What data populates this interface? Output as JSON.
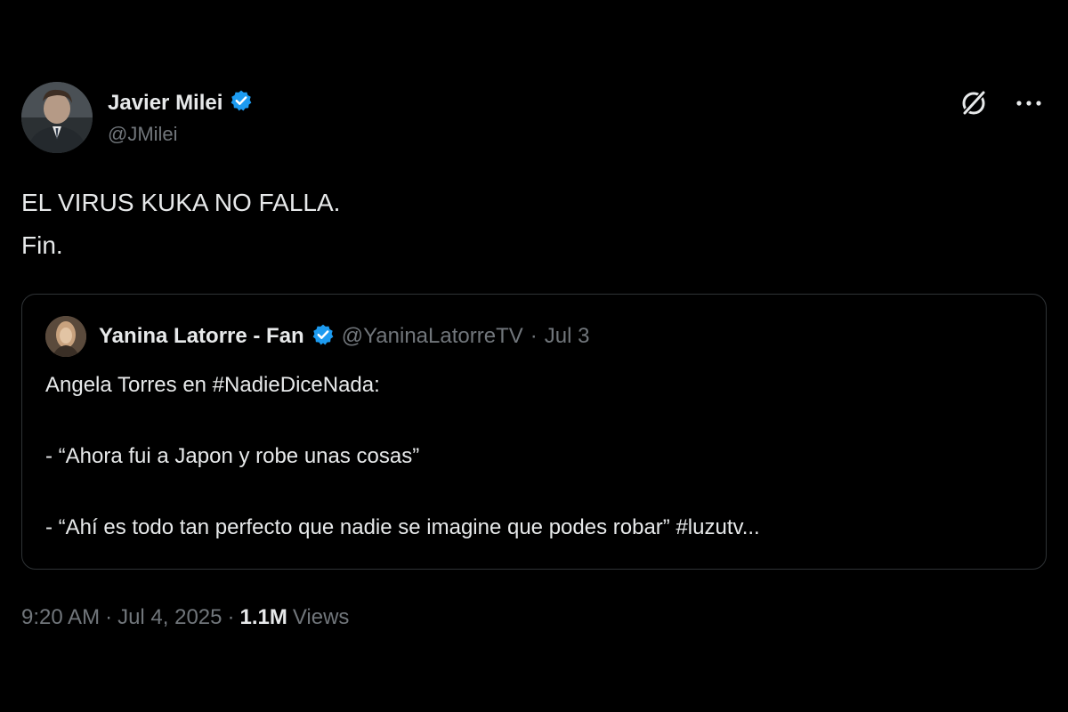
{
  "author": {
    "name": "Javier Milei",
    "handle": "@JMilei",
    "verified": true
  },
  "tweet": {
    "lines": [
      "EL VIRUS KUKA NO FALLA.",
      "Fin."
    ]
  },
  "quoted": {
    "name": "Yanina Latorre - Fan",
    "handle": "@YaninaLatorreTV",
    "separator": "·",
    "date": "Jul 3",
    "verified": true,
    "lines": [
      "Angela Torres en #NadieDiceNada:",
      "- “Ahora fui a Japon y robe unas cosas”",
      "- “Ahí es todo tan perfecto que nadie se imagine que podes robar” #luzutv..."
    ]
  },
  "meta": {
    "time": "9:20 AM",
    "separator": "·",
    "date": "Jul 4, 2025",
    "views_count": "1.1M",
    "views_label": "Views"
  },
  "icons": {
    "verified": "verified-badge-icon",
    "grok": "grok-icon",
    "more": "more-icon"
  },
  "colors": {
    "background": "#000000",
    "text": "#e7e9ea",
    "muted": "#71767b",
    "verified": "#1d9bf0",
    "border": "#2f3336"
  }
}
